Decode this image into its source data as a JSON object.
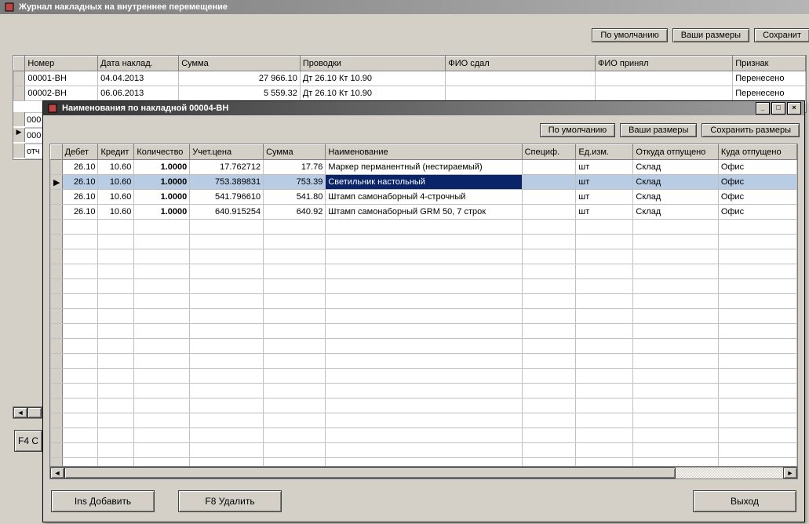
{
  "outer": {
    "title": "Журнал накладных на внутреннее перемещение",
    "toolbar": {
      "default": "По умолчанию",
      "sizes": "Ваши размеры",
      "save": "Сохранит"
    },
    "columns": {
      "number": "Номер",
      "date": "Дата наклад.",
      "sum": "Сумма",
      "entries": "Проводки",
      "gave": "ФИО сдал",
      "received": "ФИО принял",
      "flag": "Признак"
    },
    "rows": [
      {
        "number": "00001-ВН",
        "date": "04.04.2013",
        "sum": "27 966.10",
        "entries": "Дт 26.10 Кт 10.90",
        "gave": "",
        "received": "",
        "flag": "Перенесено"
      },
      {
        "number": "00002-ВН",
        "date": "06.06.2013",
        "sum": "5 559.32",
        "entries": "Дт 26.10 Кт 10.90",
        "gave": "",
        "received": "",
        "flag": "Перенесено"
      }
    ],
    "peek": {
      "row3": "000",
      "row4": "000",
      "row5": "отч"
    },
    "button_f4": "F4 С"
  },
  "inner": {
    "title": "Наименования по накладной 00004-ВН",
    "toolbar": {
      "default": "По умолчанию",
      "sizes": "Ваши размеры",
      "save": "Сохранить размеры"
    },
    "columns": {
      "debit": "Дебет",
      "credit": "Кредит",
      "qty": "Количество",
      "price": "Учет.цена",
      "sum": "Сумма",
      "name": "Наименование",
      "spec": "Специф.",
      "unit": "Ед.изм.",
      "from": "Откуда отпущено",
      "to": "Куда отпущено"
    },
    "rows": [
      {
        "debit": "26.10",
        "credit": "10.60",
        "qty": "1.0000",
        "price": "17.762712",
        "sum": "17.76",
        "name": "Маркер перманентный (нестираемый)",
        "spec": "",
        "unit": "шт",
        "from": "Склад",
        "to": "Офис"
      },
      {
        "debit": "26.10",
        "credit": "10.60",
        "qty": "1.0000",
        "price": "753.389831",
        "sum": "753.39",
        "name": "Светильник настольный",
        "spec": "",
        "unit": "шт",
        "from": "Склад",
        "to": "Офис",
        "selected": true
      },
      {
        "debit": "26.10",
        "credit": "10.60",
        "qty": "1.0000",
        "price": "541.796610",
        "sum": "541.80",
        "name": "Штамп самонаборный 4-строчный",
        "spec": "",
        "unit": "шт",
        "from": "Склад",
        "to": "Офис"
      },
      {
        "debit": "26.10",
        "credit": "10.60",
        "qty": "1.0000",
        "price": "640.915254",
        "sum": "640.92",
        "name": "Штамп самонаборный GRM 50, 7 строк",
        "spec": "",
        "unit": "шт",
        "from": "Склад",
        "to": "Офис"
      }
    ],
    "buttons": {
      "add": "Ins Добавить",
      "del": "F8 Удалить",
      "exit": "Выход"
    }
  }
}
